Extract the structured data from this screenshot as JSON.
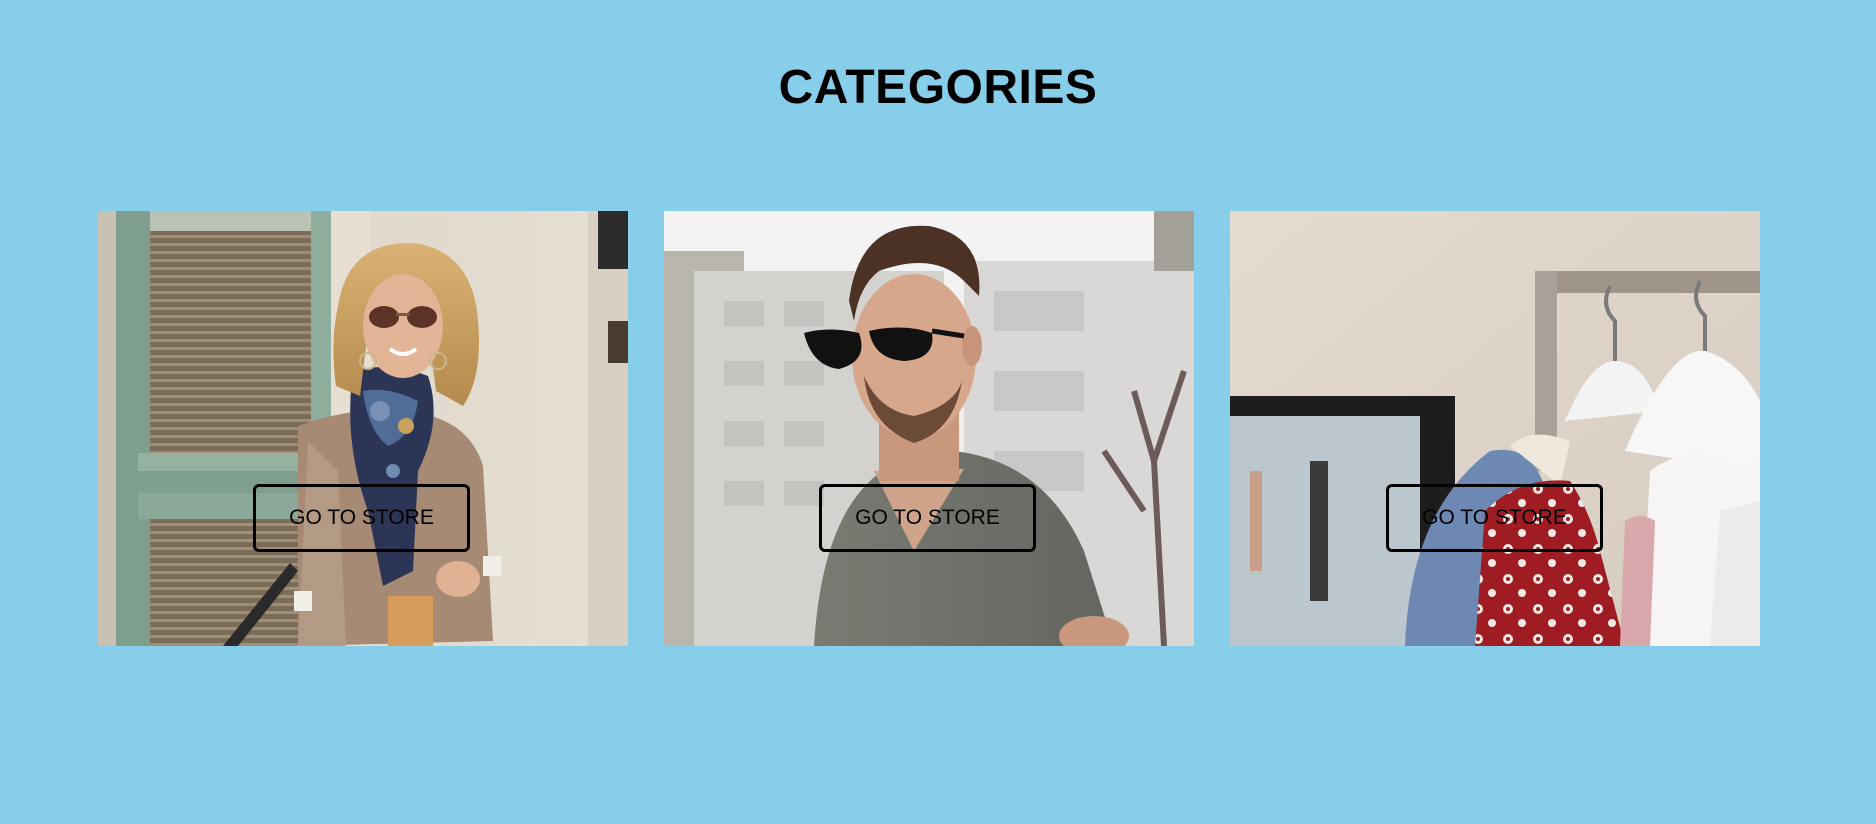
{
  "page": {
    "title": "CATEGORIES",
    "background_color": "#87CEEB"
  },
  "categories": [
    {
      "image": "woman-in-sunglasses-and-scarf-photo",
      "button_label": "GO TO STORE"
    },
    {
      "image": "man-in-sunglasses-photo",
      "button_label": "GO TO STORE"
    },
    {
      "image": "clothing-rack-photo",
      "button_label": "GO TO STORE"
    }
  ]
}
